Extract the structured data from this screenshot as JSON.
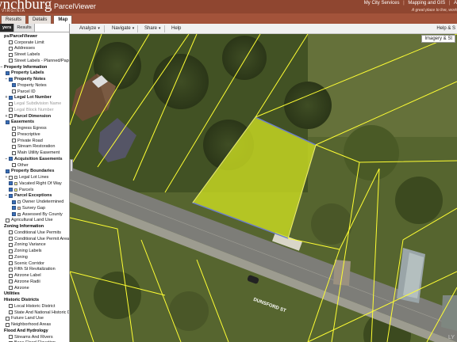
{
  "header": {
    "logo": "ynchburg",
    "logo_sub": "VIRGINIA",
    "app_name": "ParcelViewer",
    "links": [
      "My City Services",
      "Mapping and GIS",
      "A"
    ],
    "tagline": "A great place to live, work",
    "tabs": [
      "Results",
      "Details",
      "Map"
    ]
  },
  "left_tabs": [
    "yers",
    "Results"
  ],
  "layers": [
    {
      "label": "ps/ParcelViewer",
      "type": "section",
      "exp": "",
      "cb": null
    },
    {
      "label": "Corporate Limit",
      "cb": false,
      "indent": 1
    },
    {
      "label": "Addresses",
      "cb": false,
      "indent": 1
    },
    {
      "label": "Street Labels",
      "cb": false,
      "indent": 1
    },
    {
      "label": "Street Labels - Planned/Paper",
      "cb": false,
      "indent": 1
    },
    {
      "label": "Property Information",
      "type": "section",
      "exp": "-",
      "cb": null
    },
    {
      "label": "Property Labels",
      "cb": true,
      "indent": 0,
      "bold": true
    },
    {
      "label": "Property Notes",
      "cb": true,
      "indent": 1,
      "exp": "-",
      "bold": true
    },
    {
      "label": "Property Notes",
      "cb": true,
      "indent": 2
    },
    {
      "label": "Parcel ID",
      "cb": false,
      "indent": 2
    },
    {
      "label": "Legal Lot Number",
      "cb": true,
      "indent": 1,
      "exp": "+",
      "bold": true
    },
    {
      "label": "Legal Subdivision Name",
      "cb": false,
      "indent": 1,
      "dim": true
    },
    {
      "label": "Legal Block Number",
      "cb": false,
      "indent": 1,
      "dim": true
    },
    {
      "label": "Parcel Dimension",
      "cb": false,
      "indent": 1,
      "exp": "+",
      "bold": true
    },
    {
      "label": "Easements",
      "cb": true,
      "indent": 0,
      "bold": true
    },
    {
      "label": "Ingress Egress",
      "cb": false,
      "indent": 2
    },
    {
      "label": "Prescriptive",
      "cb": false,
      "indent": 2
    },
    {
      "label": "Private Road",
      "cb": false,
      "indent": 2
    },
    {
      "label": "Stream Restoration",
      "cb": false,
      "indent": 2
    },
    {
      "label": "Main Utility Easement",
      "cb": false,
      "indent": 2
    },
    {
      "label": "Acquisition Easements",
      "cb": true,
      "indent": 1,
      "exp": "-",
      "bold": true
    },
    {
      "label": "Other",
      "cb": false,
      "indent": 2
    },
    {
      "label": "Property Boundaries",
      "cb": true,
      "indent": 0,
      "bold": true
    },
    {
      "label": "Legal Lot Lines",
      "cb": false,
      "indent": 1,
      "exp": "+",
      "swatch": "#e8e8e8"
    },
    {
      "label": "Vacated Right Of Way",
      "cb": true,
      "indent": 1,
      "swatch": "#f6ef9a"
    },
    {
      "label": "Parcels",
      "cb": true,
      "indent": 1,
      "swatch": "#ffff66"
    },
    {
      "label": "Parcel Exceptions",
      "cb": true,
      "indent": 1,
      "exp": "-",
      "bold": true
    },
    {
      "label": "Owner Undetermined",
      "cb": true,
      "indent": 2,
      "swatch": "#e6f0ff"
    },
    {
      "label": "Survey Gap",
      "cb": true,
      "indent": 2,
      "swatch": "#f3c4a0"
    },
    {
      "label": "Assessed By County",
      "cb": true,
      "indent": 2,
      "swatch": "#c8c8c8"
    },
    {
      "label": "Agricultural Land Use",
      "cb": false,
      "indent": 0
    },
    {
      "label": "Zoning Information",
      "type": "section",
      "exp": "",
      "cb": null
    },
    {
      "label": "Conditional Use Permits",
      "cb": false,
      "indent": 1
    },
    {
      "label": "Conditional Use Permit Area",
      "cb": false,
      "indent": 1
    },
    {
      "label": "Zoning Variance",
      "cb": false,
      "indent": 1
    },
    {
      "label": "Zoning Labels",
      "cb": false,
      "indent": 1
    },
    {
      "label": "Zoning",
      "cb": false,
      "indent": 1
    },
    {
      "label": "Scenic Corridor",
      "cb": false,
      "indent": 1
    },
    {
      "label": "Fifth St Revitalization",
      "cb": false,
      "indent": 1
    },
    {
      "label": "Airzone Label",
      "cb": false,
      "indent": 1
    },
    {
      "label": "Airzone Radii",
      "cb": false,
      "indent": 1
    },
    {
      "label": "Airzone",
      "cb": false,
      "indent": 1
    },
    {
      "label": "Utilities",
      "type": "section",
      "exp": "",
      "cb": null
    },
    {
      "label": "Historic Districts",
      "type": "section",
      "exp": "",
      "cb": null
    },
    {
      "label": "Local Historic District",
      "cb": false,
      "indent": 1
    },
    {
      "label": "State And National Historic Di",
      "cb": false,
      "indent": 1
    },
    {
      "label": "Future Land Use",
      "cb": false,
      "indent": 0
    },
    {
      "label": "Neighborhood Areas",
      "cb": false,
      "indent": 0
    },
    {
      "label": "Flood And Hydrology",
      "type": "section",
      "exp": "",
      "cb": null
    },
    {
      "label": "Streams And Rivers",
      "cb": false,
      "indent": 1
    },
    {
      "label": "Base Flood Elevation",
      "cb": false,
      "indent": 1
    }
  ],
  "toolbar": {
    "analyze": "Analyze",
    "navigate": "Navigate",
    "share": "Share",
    "help": "Help",
    "help_link": "Help & S"
  },
  "map": {
    "imagery": "Imagery & St",
    "street": "DUNSFORD ST",
    "watermark": "LY",
    "colors": {
      "parcel_line": "#ffff33",
      "selected_fill": "#ccdd22",
      "road": "#7d7d78"
    }
  }
}
